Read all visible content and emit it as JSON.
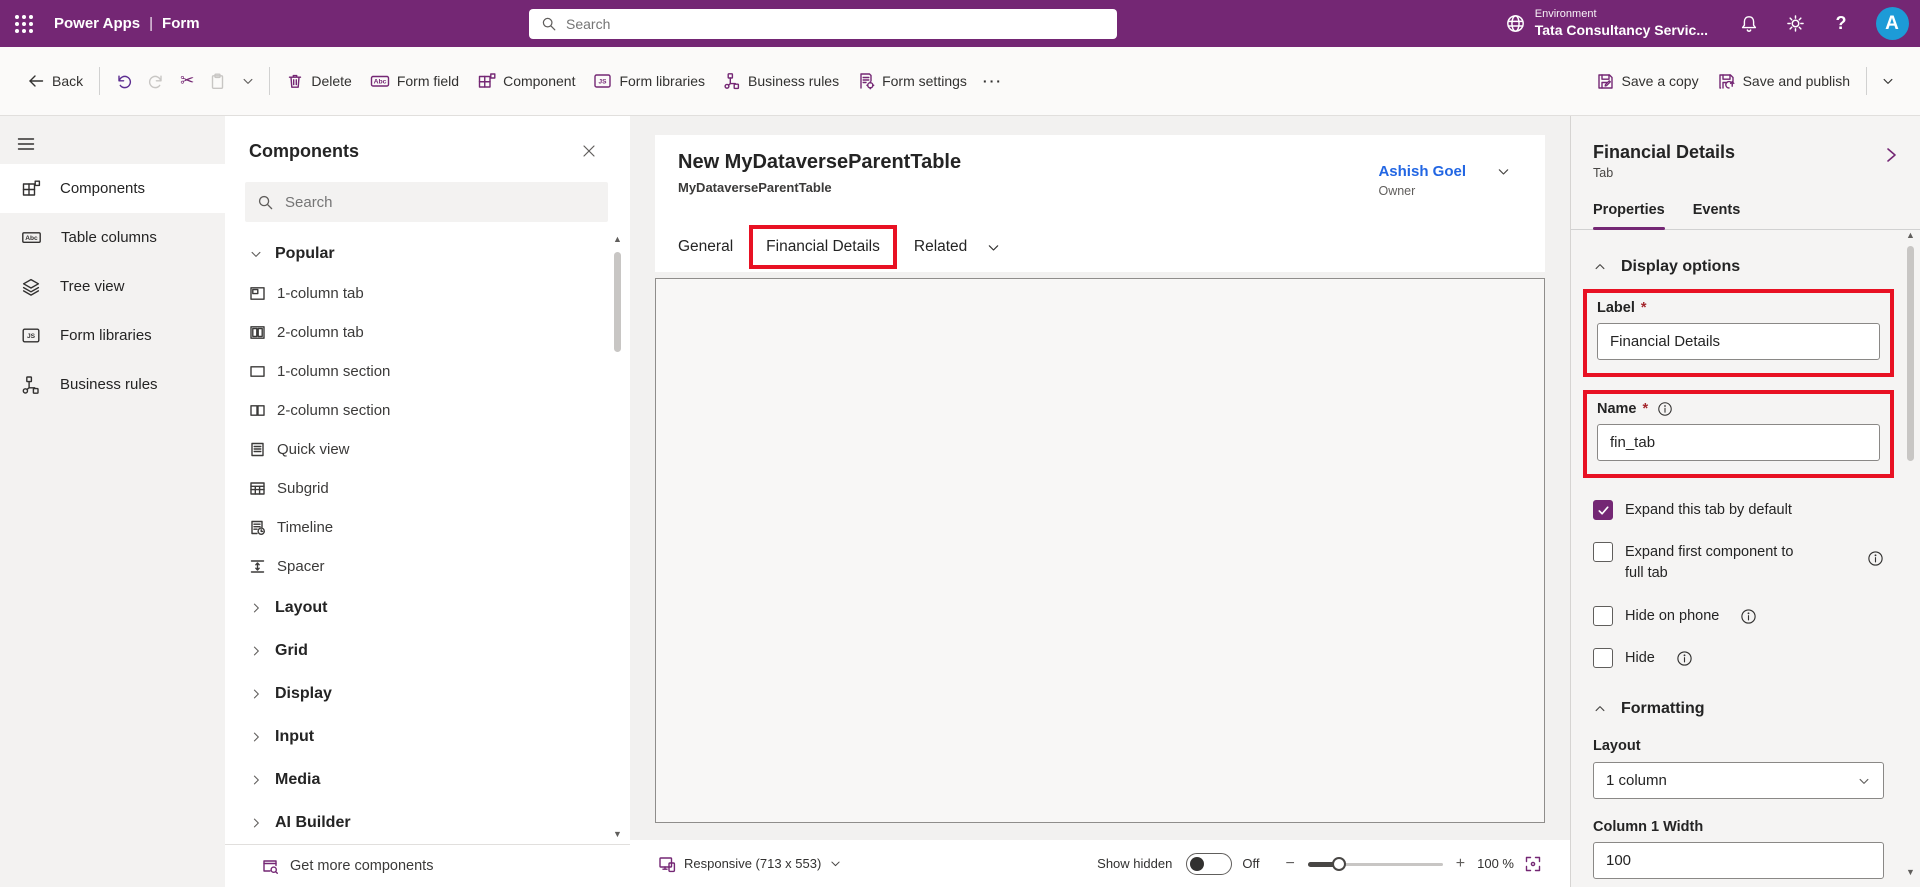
{
  "header": {
    "app_name": "Power Apps",
    "separator": "|",
    "page_name": "Form",
    "search_placeholder": "Search",
    "environment_label": "Environment",
    "environment_name": "Tata Consultancy Servic...",
    "avatar_initial": "A"
  },
  "toolbar": {
    "back_label": "Back",
    "delete_label": "Delete",
    "form_field_label": "Form field",
    "component_label": "Component",
    "form_libraries_label": "Form libraries",
    "business_rules_label": "Business rules",
    "form_settings_label": "Form settings",
    "overflow_label": "···",
    "save_a_copy_label": "Save a copy",
    "save_and_publish_label": "Save and publish"
  },
  "left_rail": {
    "items": [
      {
        "label": "Components",
        "icon": "components-icon",
        "selected": true
      },
      {
        "label": "Table columns",
        "icon": "table-columns-icon",
        "selected": false
      },
      {
        "label": "Tree view",
        "icon": "tree-view-icon",
        "selected": false
      },
      {
        "label": "Form libraries",
        "icon": "form-libraries-icon",
        "selected": false
      },
      {
        "label": "Business rules",
        "icon": "business-rules-icon",
        "selected": false
      }
    ]
  },
  "components_panel": {
    "title": "Components",
    "search_placeholder": "Search",
    "popular_section": {
      "label": "Popular",
      "items": [
        {
          "label": "1-column tab",
          "icon": "one-column-tab-icon"
        },
        {
          "label": "2-column tab",
          "icon": "two-column-tab-icon"
        },
        {
          "label": "1-column section",
          "icon": "one-column-section-icon"
        },
        {
          "label": "2-column section",
          "icon": "two-column-section-icon"
        },
        {
          "label": "Quick view",
          "icon": "quick-view-icon"
        },
        {
          "label": "Subgrid",
          "icon": "subgrid-icon"
        },
        {
          "label": "Timeline",
          "icon": "timeline-icon"
        },
        {
          "label": "Spacer",
          "icon": "spacer-icon"
        }
      ]
    },
    "collapsed_sections": [
      "Layout",
      "Grid",
      "Display",
      "Input",
      "Media",
      "AI Builder"
    ],
    "footer_link": "Get more components"
  },
  "canvas": {
    "form_title": "New MyDataverseParentTable",
    "table_name": "MyDataverseParentTable",
    "owner_name": "Ashish Goel",
    "owner_role": "Owner",
    "tabs": [
      {
        "label": "General",
        "active": false
      },
      {
        "label": "Financial Details",
        "active": true
      },
      {
        "label": "Related",
        "active": false,
        "has_dropdown": true
      }
    ]
  },
  "status_bar": {
    "view_mode": "Responsive (713 x 553)",
    "show_hidden_label": "Show hidden",
    "toggle_state": "Off",
    "zoom_level": "100 %"
  },
  "properties_panel": {
    "title": "Financial Details",
    "subtitle": "Tab",
    "tabs": [
      {
        "label": "Properties",
        "active": true
      },
      {
        "label": "Events",
        "active": false
      }
    ],
    "display_options": {
      "heading": "Display options",
      "label_field": {
        "label": "Label",
        "required_mark": "*",
        "value": "Financial Details"
      },
      "name_field": {
        "label": "Name",
        "required_mark": "*",
        "value": "fin_tab",
        "has_info": true
      },
      "checkboxes": [
        {
          "label": "Expand this tab by default",
          "checked": true,
          "has_info": false
        },
        {
          "label": "Expand first component to full tab",
          "checked": false,
          "has_info": true
        },
        {
          "label": "Hide on phone",
          "checked": false,
          "has_info": true
        },
        {
          "label": "Hide",
          "checked": false,
          "has_info": true
        }
      ]
    },
    "formatting": {
      "heading": "Formatting",
      "layout_label": "Layout",
      "layout_value": "1 column",
      "column_width_label": "Column 1 Width",
      "column_width_value": "100"
    }
  },
  "colors": {
    "brand_purple": "#742774",
    "annotation_red": "#e81123",
    "link_blue": "#2266e3",
    "avatar_blue": "#1d9bd7"
  }
}
